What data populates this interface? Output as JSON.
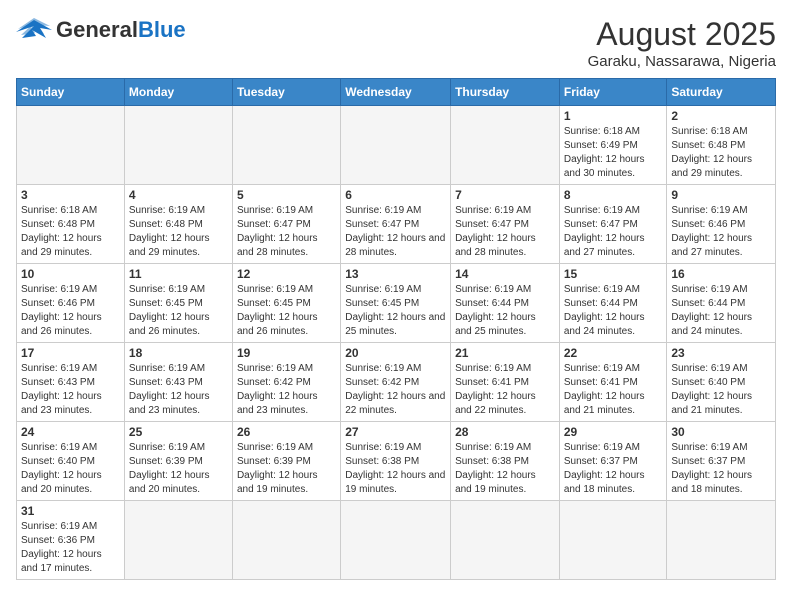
{
  "header": {
    "logo_general": "General",
    "logo_blue": "Blue",
    "month_title": "August 2025",
    "location": "Garaku, Nassarawa, Nigeria"
  },
  "days_of_week": [
    "Sunday",
    "Monday",
    "Tuesday",
    "Wednesday",
    "Thursday",
    "Friday",
    "Saturday"
  ],
  "weeks": [
    {
      "days": [
        {
          "number": "",
          "info": "",
          "empty": true
        },
        {
          "number": "",
          "info": "",
          "empty": true
        },
        {
          "number": "",
          "info": "",
          "empty": true
        },
        {
          "number": "",
          "info": "",
          "empty": true
        },
        {
          "number": "",
          "info": "",
          "empty": true
        },
        {
          "number": "1",
          "info": "Sunrise: 6:18 AM\nSunset: 6:49 PM\nDaylight: 12 hours and 30 minutes."
        },
        {
          "number": "2",
          "info": "Sunrise: 6:18 AM\nSunset: 6:48 PM\nDaylight: 12 hours and 29 minutes."
        }
      ]
    },
    {
      "days": [
        {
          "number": "3",
          "info": "Sunrise: 6:18 AM\nSunset: 6:48 PM\nDaylight: 12 hours and 29 minutes."
        },
        {
          "number": "4",
          "info": "Sunrise: 6:19 AM\nSunset: 6:48 PM\nDaylight: 12 hours and 29 minutes."
        },
        {
          "number": "5",
          "info": "Sunrise: 6:19 AM\nSunset: 6:47 PM\nDaylight: 12 hours and 28 minutes."
        },
        {
          "number": "6",
          "info": "Sunrise: 6:19 AM\nSunset: 6:47 PM\nDaylight: 12 hours and 28 minutes."
        },
        {
          "number": "7",
          "info": "Sunrise: 6:19 AM\nSunset: 6:47 PM\nDaylight: 12 hours and 28 minutes."
        },
        {
          "number": "8",
          "info": "Sunrise: 6:19 AM\nSunset: 6:47 PM\nDaylight: 12 hours and 27 minutes."
        },
        {
          "number": "9",
          "info": "Sunrise: 6:19 AM\nSunset: 6:46 PM\nDaylight: 12 hours and 27 minutes."
        }
      ]
    },
    {
      "days": [
        {
          "number": "10",
          "info": "Sunrise: 6:19 AM\nSunset: 6:46 PM\nDaylight: 12 hours and 26 minutes."
        },
        {
          "number": "11",
          "info": "Sunrise: 6:19 AM\nSunset: 6:45 PM\nDaylight: 12 hours and 26 minutes."
        },
        {
          "number": "12",
          "info": "Sunrise: 6:19 AM\nSunset: 6:45 PM\nDaylight: 12 hours and 26 minutes."
        },
        {
          "number": "13",
          "info": "Sunrise: 6:19 AM\nSunset: 6:45 PM\nDaylight: 12 hours and 25 minutes."
        },
        {
          "number": "14",
          "info": "Sunrise: 6:19 AM\nSunset: 6:44 PM\nDaylight: 12 hours and 25 minutes."
        },
        {
          "number": "15",
          "info": "Sunrise: 6:19 AM\nSunset: 6:44 PM\nDaylight: 12 hours and 24 minutes."
        },
        {
          "number": "16",
          "info": "Sunrise: 6:19 AM\nSunset: 6:44 PM\nDaylight: 12 hours and 24 minutes."
        }
      ]
    },
    {
      "days": [
        {
          "number": "17",
          "info": "Sunrise: 6:19 AM\nSunset: 6:43 PM\nDaylight: 12 hours and 23 minutes."
        },
        {
          "number": "18",
          "info": "Sunrise: 6:19 AM\nSunset: 6:43 PM\nDaylight: 12 hours and 23 minutes."
        },
        {
          "number": "19",
          "info": "Sunrise: 6:19 AM\nSunset: 6:42 PM\nDaylight: 12 hours and 23 minutes."
        },
        {
          "number": "20",
          "info": "Sunrise: 6:19 AM\nSunset: 6:42 PM\nDaylight: 12 hours and 22 minutes."
        },
        {
          "number": "21",
          "info": "Sunrise: 6:19 AM\nSunset: 6:41 PM\nDaylight: 12 hours and 22 minutes."
        },
        {
          "number": "22",
          "info": "Sunrise: 6:19 AM\nSunset: 6:41 PM\nDaylight: 12 hours and 21 minutes."
        },
        {
          "number": "23",
          "info": "Sunrise: 6:19 AM\nSunset: 6:40 PM\nDaylight: 12 hours and 21 minutes."
        }
      ]
    },
    {
      "days": [
        {
          "number": "24",
          "info": "Sunrise: 6:19 AM\nSunset: 6:40 PM\nDaylight: 12 hours and 20 minutes."
        },
        {
          "number": "25",
          "info": "Sunrise: 6:19 AM\nSunset: 6:39 PM\nDaylight: 12 hours and 20 minutes."
        },
        {
          "number": "26",
          "info": "Sunrise: 6:19 AM\nSunset: 6:39 PM\nDaylight: 12 hours and 19 minutes."
        },
        {
          "number": "27",
          "info": "Sunrise: 6:19 AM\nSunset: 6:38 PM\nDaylight: 12 hours and 19 minutes."
        },
        {
          "number": "28",
          "info": "Sunrise: 6:19 AM\nSunset: 6:38 PM\nDaylight: 12 hours and 19 minutes."
        },
        {
          "number": "29",
          "info": "Sunrise: 6:19 AM\nSunset: 6:37 PM\nDaylight: 12 hours and 18 minutes."
        },
        {
          "number": "30",
          "info": "Sunrise: 6:19 AM\nSunset: 6:37 PM\nDaylight: 12 hours and 18 minutes."
        }
      ]
    },
    {
      "days": [
        {
          "number": "31",
          "info": "Sunrise: 6:19 AM\nSunset: 6:36 PM\nDaylight: 12 hours and 17 minutes.",
          "last_row": true
        },
        {
          "number": "",
          "info": "",
          "empty": true,
          "last_row": true
        },
        {
          "number": "",
          "info": "",
          "empty": true,
          "last_row": true
        },
        {
          "number": "",
          "info": "",
          "empty": true,
          "last_row": true
        },
        {
          "number": "",
          "info": "",
          "empty": true,
          "last_row": true
        },
        {
          "number": "",
          "info": "",
          "empty": true,
          "last_row": true
        },
        {
          "number": "",
          "info": "",
          "empty": true,
          "last_row": true
        }
      ]
    }
  ]
}
